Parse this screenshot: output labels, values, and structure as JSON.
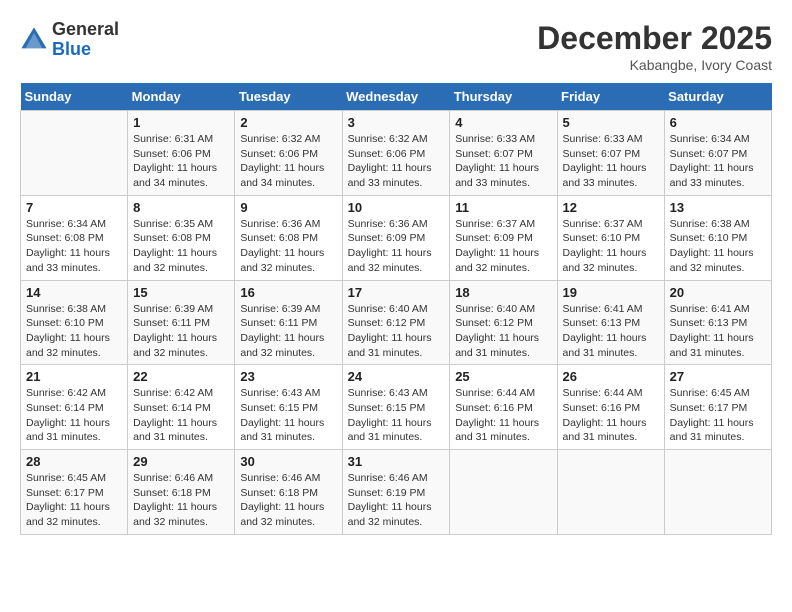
{
  "header": {
    "logo_general": "General",
    "logo_blue": "Blue",
    "month": "December 2025",
    "location": "Kabangbe, Ivory Coast"
  },
  "days_of_week": [
    "Sunday",
    "Monday",
    "Tuesday",
    "Wednesday",
    "Thursday",
    "Friday",
    "Saturday"
  ],
  "weeks": [
    [
      {
        "day": "",
        "info": ""
      },
      {
        "day": "1",
        "info": "Sunrise: 6:31 AM\nSunset: 6:06 PM\nDaylight: 11 hours and 34 minutes."
      },
      {
        "day": "2",
        "info": "Sunrise: 6:32 AM\nSunset: 6:06 PM\nDaylight: 11 hours and 34 minutes."
      },
      {
        "day": "3",
        "info": "Sunrise: 6:32 AM\nSunset: 6:06 PM\nDaylight: 11 hours and 33 minutes."
      },
      {
        "day": "4",
        "info": "Sunrise: 6:33 AM\nSunset: 6:07 PM\nDaylight: 11 hours and 33 minutes."
      },
      {
        "day": "5",
        "info": "Sunrise: 6:33 AM\nSunset: 6:07 PM\nDaylight: 11 hours and 33 minutes."
      },
      {
        "day": "6",
        "info": "Sunrise: 6:34 AM\nSunset: 6:07 PM\nDaylight: 11 hours and 33 minutes."
      }
    ],
    [
      {
        "day": "7",
        "info": "Sunrise: 6:34 AM\nSunset: 6:08 PM\nDaylight: 11 hours and 33 minutes."
      },
      {
        "day": "8",
        "info": "Sunrise: 6:35 AM\nSunset: 6:08 PM\nDaylight: 11 hours and 32 minutes."
      },
      {
        "day": "9",
        "info": "Sunrise: 6:36 AM\nSunset: 6:08 PM\nDaylight: 11 hours and 32 minutes."
      },
      {
        "day": "10",
        "info": "Sunrise: 6:36 AM\nSunset: 6:09 PM\nDaylight: 11 hours and 32 minutes."
      },
      {
        "day": "11",
        "info": "Sunrise: 6:37 AM\nSunset: 6:09 PM\nDaylight: 11 hours and 32 minutes."
      },
      {
        "day": "12",
        "info": "Sunrise: 6:37 AM\nSunset: 6:10 PM\nDaylight: 11 hours and 32 minutes."
      },
      {
        "day": "13",
        "info": "Sunrise: 6:38 AM\nSunset: 6:10 PM\nDaylight: 11 hours and 32 minutes."
      }
    ],
    [
      {
        "day": "14",
        "info": "Sunrise: 6:38 AM\nSunset: 6:10 PM\nDaylight: 11 hours and 32 minutes."
      },
      {
        "day": "15",
        "info": "Sunrise: 6:39 AM\nSunset: 6:11 PM\nDaylight: 11 hours and 32 minutes."
      },
      {
        "day": "16",
        "info": "Sunrise: 6:39 AM\nSunset: 6:11 PM\nDaylight: 11 hours and 32 minutes."
      },
      {
        "day": "17",
        "info": "Sunrise: 6:40 AM\nSunset: 6:12 PM\nDaylight: 11 hours and 31 minutes."
      },
      {
        "day": "18",
        "info": "Sunrise: 6:40 AM\nSunset: 6:12 PM\nDaylight: 11 hours and 31 minutes."
      },
      {
        "day": "19",
        "info": "Sunrise: 6:41 AM\nSunset: 6:13 PM\nDaylight: 11 hours and 31 minutes."
      },
      {
        "day": "20",
        "info": "Sunrise: 6:41 AM\nSunset: 6:13 PM\nDaylight: 11 hours and 31 minutes."
      }
    ],
    [
      {
        "day": "21",
        "info": "Sunrise: 6:42 AM\nSunset: 6:14 PM\nDaylight: 11 hours and 31 minutes."
      },
      {
        "day": "22",
        "info": "Sunrise: 6:42 AM\nSunset: 6:14 PM\nDaylight: 11 hours and 31 minutes."
      },
      {
        "day": "23",
        "info": "Sunrise: 6:43 AM\nSunset: 6:15 PM\nDaylight: 11 hours and 31 minutes."
      },
      {
        "day": "24",
        "info": "Sunrise: 6:43 AM\nSunset: 6:15 PM\nDaylight: 11 hours and 31 minutes."
      },
      {
        "day": "25",
        "info": "Sunrise: 6:44 AM\nSunset: 6:16 PM\nDaylight: 11 hours and 31 minutes."
      },
      {
        "day": "26",
        "info": "Sunrise: 6:44 AM\nSunset: 6:16 PM\nDaylight: 11 hours and 31 minutes."
      },
      {
        "day": "27",
        "info": "Sunrise: 6:45 AM\nSunset: 6:17 PM\nDaylight: 11 hours and 31 minutes."
      }
    ],
    [
      {
        "day": "28",
        "info": "Sunrise: 6:45 AM\nSunset: 6:17 PM\nDaylight: 11 hours and 32 minutes."
      },
      {
        "day": "29",
        "info": "Sunrise: 6:46 AM\nSunset: 6:18 PM\nDaylight: 11 hours and 32 minutes."
      },
      {
        "day": "30",
        "info": "Sunrise: 6:46 AM\nSunset: 6:18 PM\nDaylight: 11 hours and 32 minutes."
      },
      {
        "day": "31",
        "info": "Sunrise: 6:46 AM\nSunset: 6:19 PM\nDaylight: 11 hours and 32 minutes."
      },
      {
        "day": "",
        "info": ""
      },
      {
        "day": "",
        "info": ""
      },
      {
        "day": "",
        "info": ""
      }
    ]
  ]
}
